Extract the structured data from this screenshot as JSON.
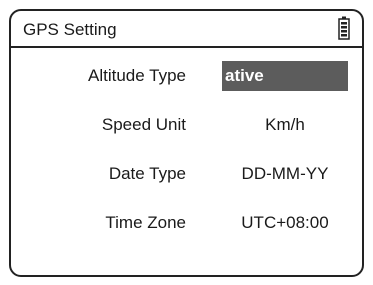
{
  "window": {
    "title": "GPS Setting",
    "battery_icon": "battery-icon"
  },
  "settings": [
    {
      "label": "Altitude Type",
      "value": "ative",
      "selected": true
    },
    {
      "label": "Speed Unit",
      "value": "Km/h",
      "selected": false
    },
    {
      "label": "Date Type",
      "value": "DD-MM-YY",
      "selected": false
    },
    {
      "label": "Time Zone",
      "value": "UTC+08:00",
      "selected": false
    }
  ],
  "colors": {
    "border": "#222222",
    "selection_background": "#5c5c5c",
    "selection_text": "#ffffff",
    "text": "#1a1a1a"
  }
}
